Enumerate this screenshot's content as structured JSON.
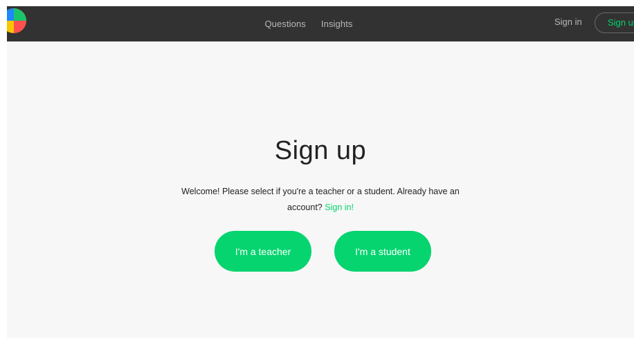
{
  "nav": {
    "logo": "logo-icon",
    "links": [
      {
        "label": "Questions"
      },
      {
        "label": "Insights"
      }
    ],
    "sign_in": "Sign in",
    "sign_up": "Sign up"
  },
  "main": {
    "title": "Sign up",
    "intro_text": "Welcome! Please select if you're a teacher or a student. Already have an account?",
    "sign_in_link": "Sign in!",
    "teacher_button": "I'm a teacher",
    "student_button": "I'm a student"
  },
  "colors": {
    "navbar": "#323232",
    "background": "#f7f7f7",
    "accent": "#05d46f",
    "nav_text": "#b9b9b9"
  }
}
